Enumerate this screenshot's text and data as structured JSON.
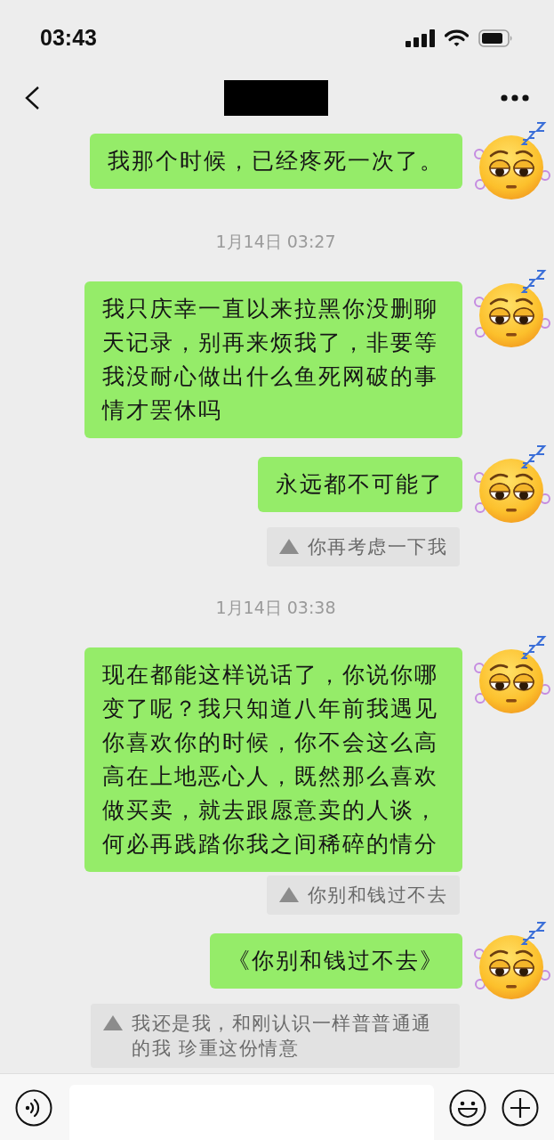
{
  "status_bar": {
    "time": "03:43"
  },
  "messages": [
    {
      "kind": "message",
      "text": "我那个时候，已经疼死一次了。"
    },
    {
      "kind": "time",
      "text": "1月14日 03:27"
    },
    {
      "kind": "message",
      "text": "我只庆幸一直以来拉黑你没删聊天记录，别再来烦我了，非要等我没耐心做出什么鱼死网破的事情才罢休吗"
    },
    {
      "kind": "message",
      "text": "永远都不可能了",
      "quote": "你再考虑一下我"
    },
    {
      "kind": "time",
      "text": "1月14日 03:38"
    },
    {
      "kind": "message",
      "text": "现在都能这样说话了，你说你哪变了呢？我只知道八年前我遇见你喜欢你的时候，你不会这么高高在上地恶心人，既然那么喜欢做买卖，就去跟愿意卖的人谈，何必再践踏你我之间稀碎的情分",
      "quote": "你别和钱过不去"
    },
    {
      "kind": "message",
      "text": "《你别和钱过不去》",
      "quote": "我还是我，和刚认识一样普普通通的我 珍重这份情意"
    }
  ]
}
